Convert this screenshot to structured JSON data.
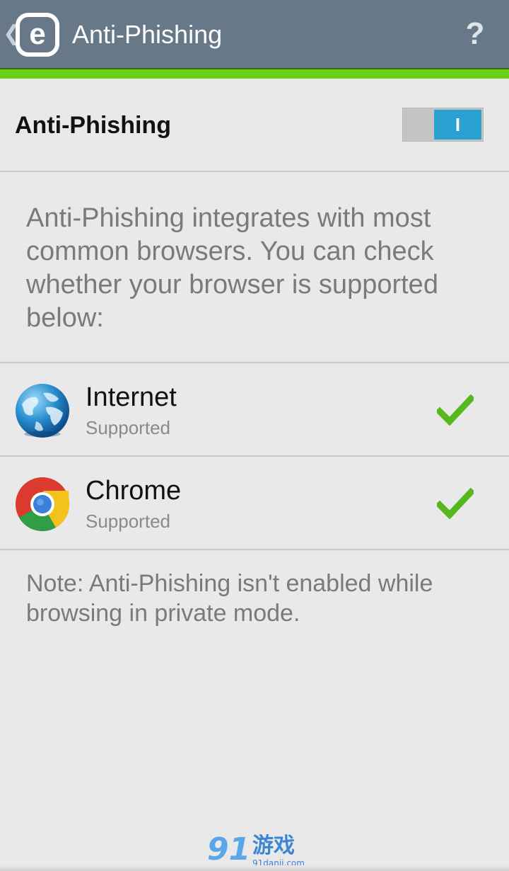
{
  "header": {
    "app_logo_letter": "e",
    "title": "Anti-Phishing",
    "help_icon": "?",
    "colors": {
      "bar": "#677889",
      "accent": "#6ccf19"
    }
  },
  "toggle_row": {
    "label": "Anti-Phishing",
    "toggle_state_text": "I",
    "enabled": true,
    "toggle_color": "#2aa1d0"
  },
  "description": "Anti-Phishing integrates with most common browsers. You can check whether your browser is supported below:",
  "browsers": [
    {
      "name": "Internet",
      "status": "Supported",
      "icon": "globe-icon"
    },
    {
      "name": "Chrome",
      "status": "Supported",
      "icon": "chrome-icon"
    }
  ],
  "note": "Note: Anti-Phishing isn't enabled while browsing in private mode.",
  "watermark": {
    "brand": "91",
    "cn": "游戏",
    "url": "91danji.com"
  }
}
